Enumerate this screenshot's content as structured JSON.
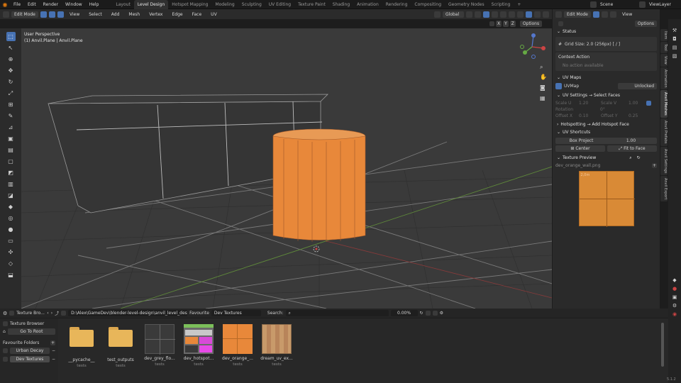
{
  "top_menu": [
    "File",
    "Edit",
    "Render",
    "Window",
    "Help"
  ],
  "workspaces": [
    "Layout",
    "Level Design",
    "Hotspot Mapping",
    "Modeling",
    "Sculpting",
    "UV Editing",
    "Texture Paint",
    "Shading",
    "Animation",
    "Rendering",
    "Compositing",
    "Geometry Nodes",
    "Scripting"
  ],
  "active_workspace": "Level Design",
  "scene": {
    "scene_label": "Scene",
    "view_layer": "ViewLayer"
  },
  "viewport_header": {
    "mode": "Edit Mode",
    "menus": [
      "View",
      "Select",
      "Add",
      "Mesh",
      "Vertex",
      "Edge",
      "Face",
      "UV"
    ],
    "orientation": "Global",
    "axes": [
      "X",
      "Y",
      "Z"
    ],
    "options": "Options"
  },
  "viewport_overlay": {
    "line1": "User Perspective",
    "line2": "(1) Anvil.Plane | Anvil.Plane"
  },
  "npanel": {
    "status_title": "Status",
    "grid_size": "Grid Size: 2.0 (256px) [ / ]",
    "context_action": "Context Action",
    "no_action": "No action available",
    "uv_maps_title": "UV Maps",
    "uv_map_name": "UVMap",
    "unlocked": "Unlocked",
    "uv_settings_title": "UV Settings → Select Faces",
    "scale_u_label": "Scale U",
    "scale_u": "1.20",
    "scale_v_label": "Scale V",
    "scale_v": "1.00",
    "rotation_label": "Rotation",
    "rotation": "0°",
    "offset_x_label": "Offset X",
    "offset_x": "0.10",
    "offset_y_label": "Offset Y",
    "offset_y": "0.25",
    "hotspotting_title": "Hotspotting → Add Hotspot Face",
    "uv_shortcuts_title": "UV Shortcuts",
    "box_project_label": "Box Project",
    "box_project_value": "1.00",
    "center": "Center",
    "fit_to_face": "Fit to Face",
    "texture_preview_title": "Texture Preview",
    "texture_name": "dev_orange_wall.png",
    "texture_overlay": "2,0m"
  },
  "vertical_tabs": [
    "Item",
    "Tool",
    "View",
    "Animation",
    "Anvil Meshes",
    "Anvil Prefabs",
    "Anvil Settings",
    "Anvil Export"
  ],
  "file_browser": {
    "editor_name": "Texture Bro...",
    "path": "D:\\Alex\\GameDev\\blender-level-design\\anvil_level_design\\...",
    "favourite_label": "Favourite",
    "favourite_value": "Dev Textures",
    "search_label": "Search:",
    "search_placeholder": "",
    "zoom": "0.00%",
    "texture_browser": "Texture Browser",
    "go_to_root": "Go To Root",
    "favourite_folders": "Favourite Folders",
    "folders": [
      "Urban Decay",
      "Dev Textures"
    ],
    "items": [
      {
        "name": "__pycache__",
        "sub": "tests"
      },
      {
        "name": "test_outputs",
        "sub": "tests"
      },
      {
        "name": "dev_grey_flo...",
        "sub": "tests"
      },
      {
        "name": "dev_hotspot...",
        "sub": "tests"
      },
      {
        "name": "dev_orange_...",
        "sub": "tests"
      },
      {
        "name": "dream_uv_ex...",
        "sub": "tests"
      }
    ]
  },
  "version": "5.1.2",
  "colors": {
    "accent": "#4772b3",
    "orange": "#e8883a",
    "background": "#3d3d3d"
  }
}
